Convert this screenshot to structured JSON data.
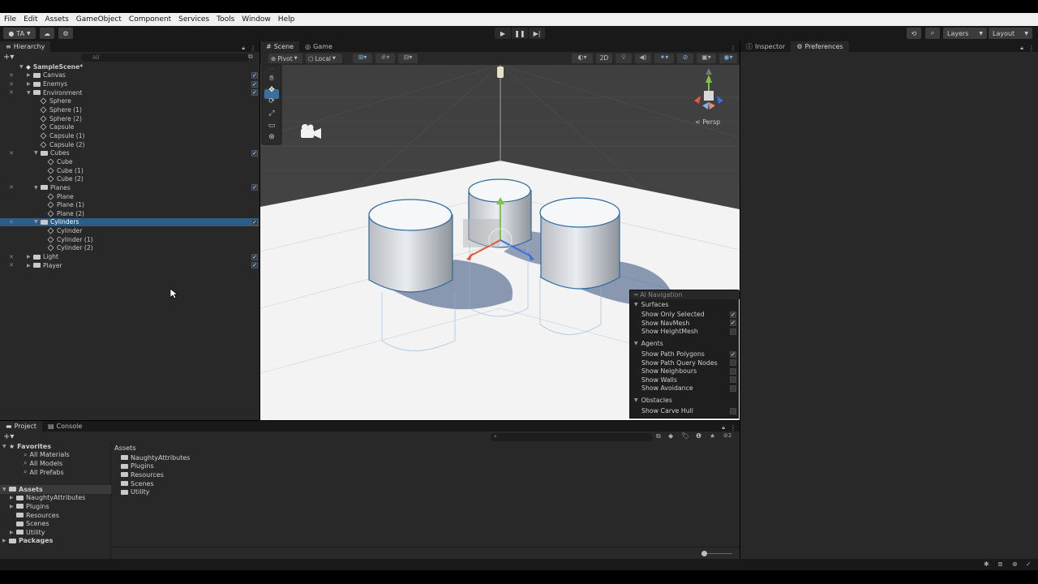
{
  "menu": [
    "File",
    "Edit",
    "Assets",
    "GameObject",
    "Component",
    "Services",
    "Tools",
    "Window",
    "Help"
  ],
  "toolbar": {
    "account": "TA",
    "layers": "Layers",
    "layout": "Layout"
  },
  "hierarchy": {
    "tab": "Hierarchy",
    "search_placeholder": "All",
    "rows": [
      {
        "label": "SampleScene*",
        "indent": 0,
        "bold": true,
        "arrow": "▼",
        "icon": "scene"
      },
      {
        "label": "Canvas",
        "indent": 1,
        "arrow": "▶",
        "icon": "folder",
        "vis": true,
        "check": true
      },
      {
        "label": "Enemys",
        "indent": 1,
        "arrow": "▶",
        "icon": "folder",
        "vis": true,
        "check": true
      },
      {
        "label": "Environment",
        "indent": 1,
        "arrow": "▼",
        "icon": "folder",
        "vis": true,
        "check": true
      },
      {
        "label": "Sphere",
        "indent": 2,
        "icon": "cube"
      },
      {
        "label": "Sphere (1)",
        "indent": 2,
        "icon": "cube"
      },
      {
        "label": "Sphere (2)",
        "indent": 2,
        "icon": "cube"
      },
      {
        "label": "Capsule",
        "indent": 2,
        "icon": "cube"
      },
      {
        "label": "Capsule (1)",
        "indent": 2,
        "icon": "cube"
      },
      {
        "label": "Capsule (2)",
        "indent": 2,
        "icon": "cube"
      },
      {
        "label": "Cubes",
        "indent": 2,
        "arrow": "▼",
        "icon": "folder",
        "vis": true,
        "check": true
      },
      {
        "label": "Cube",
        "indent": 3,
        "icon": "cube"
      },
      {
        "label": "Cube (1)",
        "indent": 3,
        "icon": "cube"
      },
      {
        "label": "Cube (2)",
        "indent": 3,
        "icon": "cube"
      },
      {
        "label": "Planes",
        "indent": 2,
        "arrow": "▼",
        "icon": "folder",
        "vis": true,
        "check": true
      },
      {
        "label": "Plane",
        "indent": 3,
        "icon": "cube"
      },
      {
        "label": "Plane (1)",
        "indent": 3,
        "icon": "cube"
      },
      {
        "label": "Plane (2)",
        "indent": 3,
        "icon": "cube"
      },
      {
        "label": "Cylinders",
        "indent": 2,
        "arrow": "▼",
        "icon": "folder",
        "vis": true,
        "check": true,
        "selected": true
      },
      {
        "label": "Cylinder",
        "indent": 3,
        "icon": "cube"
      },
      {
        "label": "Cylinder (1)",
        "indent": 3,
        "icon": "cube"
      },
      {
        "label": "Cylinder (2)",
        "indent": 3,
        "icon": "cube"
      },
      {
        "label": "Light",
        "indent": 1,
        "arrow": "▶",
        "icon": "folder",
        "vis": true,
        "check": true
      },
      {
        "label": "Player",
        "indent": 1,
        "arrow": "▶",
        "icon": "folder",
        "vis": true,
        "check": true
      }
    ]
  },
  "scene": {
    "tabs": [
      "Scene",
      "Game"
    ],
    "pivot": "Pivot",
    "local": "Local",
    "mode_2d": "2D",
    "persp": "Persp"
  },
  "ai_navigation": {
    "title": "AI Navigation",
    "sections": [
      {
        "name": "Surfaces",
        "items": [
          {
            "label": "Show Only Selected",
            "checked": true
          },
          {
            "label": "Show NavMesh",
            "checked": true
          },
          {
            "label": "Show HeightMesh",
            "checked": false
          }
        ]
      },
      {
        "name": "Agents",
        "items": [
          {
            "label": "Show Path Polygons",
            "checked": true
          },
          {
            "label": "Show Path Query Nodes",
            "checked": false
          },
          {
            "label": "Show Neighbours",
            "checked": false
          },
          {
            "label": "Show Walls",
            "checked": false
          },
          {
            "label": "Show Avoidance",
            "checked": false
          }
        ]
      },
      {
        "name": "Obstacles",
        "items": [
          {
            "label": "Show Carve Hull",
            "checked": false
          }
        ]
      }
    ]
  },
  "right_panel": {
    "tabs": [
      "Inspector",
      "Preferences"
    ]
  },
  "bottom": {
    "tabs": [
      "Project",
      "Console"
    ],
    "hidden_count": "2",
    "breadcrumb": "Assets",
    "tree": [
      {
        "label": "Favorites",
        "indent": 0,
        "bold": true,
        "arrow": "▼",
        "icon": "star"
      },
      {
        "label": "All Materials",
        "indent": 2,
        "icon": "search"
      },
      {
        "label": "All Models",
        "indent": 2,
        "icon": "search"
      },
      {
        "label": "All Prefabs",
        "indent": 2,
        "icon": "search"
      },
      {
        "label": "",
        "indent": 0,
        "spacer": true
      },
      {
        "label": "Assets",
        "indent": 0,
        "bold": true,
        "arrow": "▼",
        "icon": "folder",
        "selected": true
      },
      {
        "label": "NaughtyAttributes",
        "indent": 1,
        "arrow": "▶",
        "icon": "folder"
      },
      {
        "label": "Plugins",
        "indent": 1,
        "arrow": "▶",
        "icon": "folder"
      },
      {
        "label": "Resources",
        "indent": 1,
        "icon": "folder"
      },
      {
        "label": "Scenes",
        "indent": 1,
        "icon": "folder"
      },
      {
        "label": "Utility",
        "indent": 1,
        "arrow": "▶",
        "icon": "folder"
      },
      {
        "label": "Packages",
        "indent": 0,
        "bold": true,
        "arrow": "▶",
        "icon": "folder"
      }
    ],
    "assets": [
      "NaughtyAttributes",
      "Plugins",
      "Resources",
      "Scenes",
      "Utility"
    ]
  }
}
